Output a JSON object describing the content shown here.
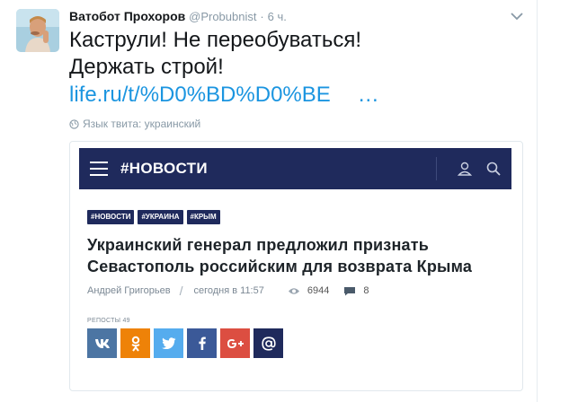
{
  "tweet": {
    "author_name": "Ватобот Прохоров",
    "author_handle": "@Probubnist",
    "dot": "·",
    "time": "6 ч.",
    "text_line1": "Каструли! Не переобуваться!",
    "text_line2": "Держать строй!",
    "link_text": "life.ru/t/%D0%BD%D0%BE",
    "link_ellipsis": "…",
    "language_note": "Язык твита: украинский"
  },
  "card": {
    "nav_title": "#НОВОСТИ",
    "tags": [
      "#НОВОСТИ",
      "#УКРАИНА",
      "#КРЫМ"
    ],
    "headline_line1": "Украинский генерал предложил признать",
    "headline_line2": "Севастополь российским для возврата Крыма",
    "author": "Андрей Григорьев",
    "slash": "/",
    "date": "сегодня в 11:57",
    "views": "6944",
    "comments": "8",
    "reposts_label": "РЕПОСТЫ 49",
    "shares": [
      {
        "network": "vk",
        "icon": "vk-icon",
        "color": "#4c75a3"
      },
      {
        "network": "odnoklassniki",
        "icon": "ok-icon",
        "color": "#ee8208"
      },
      {
        "network": "twitter",
        "icon": "twitter-icon",
        "color": "#55acee"
      },
      {
        "network": "facebook",
        "icon": "facebook-icon",
        "color": "#3b5998"
      },
      {
        "network": "google-plus",
        "icon": "google-plus-icon",
        "color": "#dc4e41"
      },
      {
        "network": "email",
        "icon": "email-icon",
        "color": "#1f2a5c"
      }
    ]
  },
  "colors": {
    "link": "#1b95e0",
    "card_nav": "#1f2a5c",
    "muted": "#8899a6"
  }
}
